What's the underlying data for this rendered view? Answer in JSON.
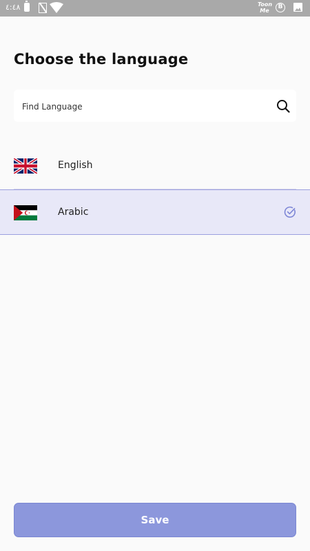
{
  "status_bar": {
    "time": "٤:٤٨",
    "app_badge": "Toon Me",
    "b_icon_label": "B",
    "icons": [
      "battery-icon",
      "no-sim-icon",
      "wifi-icon",
      "toonme-icon",
      "b-circle-icon",
      "image-icon"
    ]
  },
  "page": {
    "title": "Choose the language"
  },
  "search": {
    "placeholder": "Find Language",
    "value": "",
    "icon": "search-icon"
  },
  "languages": [
    {
      "label": "English",
      "flag": "uk-flag-icon",
      "selected": false
    },
    {
      "label": "Arabic",
      "flag": "sahrawi-flag-icon",
      "selected": true
    }
  ],
  "actions": {
    "save_label": "Save"
  },
  "colors": {
    "accent": "#8c97dc",
    "selected_row_bg": "#e8e8f8",
    "selected_border": "#9b9fdf",
    "check": "#7d86d6",
    "status_bar": "#a9a9a9"
  }
}
